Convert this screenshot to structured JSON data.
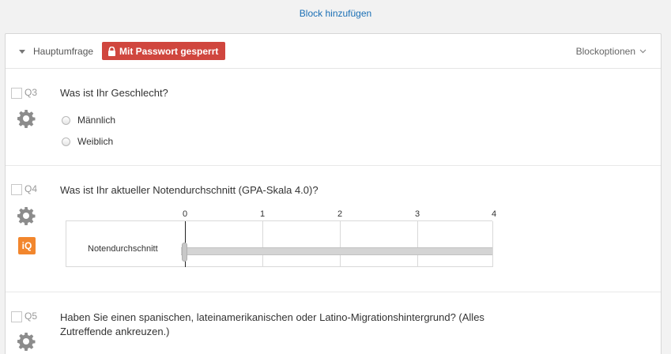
{
  "add_block_label": "Block hinzufügen",
  "block": {
    "title": "Hauptumfrage",
    "lock_label": "Mit Passwort gesperrt",
    "lock_color": "#d0463e",
    "options_label": "Blockoptionen"
  },
  "questions": [
    {
      "id": "Q3",
      "text": "Was ist Ihr Geschlecht?",
      "choices": [
        "Männlich",
        "Weiblich"
      ]
    },
    {
      "id": "Q4",
      "text": "Was ist Ihr aktueller Notendurchschnitt (GPA-Skala 4.0)?",
      "slider": {
        "ticks": [
          "0",
          "1",
          "2",
          "3",
          "4"
        ],
        "min": 0,
        "max": 4,
        "statement": "Notendurchschnitt",
        "value": 0
      },
      "iq_label": "iQ"
    },
    {
      "id": "Q5",
      "text": "Haben Sie einen spanischen, lateinamerikanischen oder Latino-Migrationshintergrund? (Alles Zutreffende ankreuzen.)"
    }
  ],
  "icons": [
    "chevron-down-icon",
    "lock-icon",
    "gear-icon",
    "iq-icon"
  ],
  "colors": {
    "link": "#1a6fb5",
    "iq": "#f2862d"
  }
}
